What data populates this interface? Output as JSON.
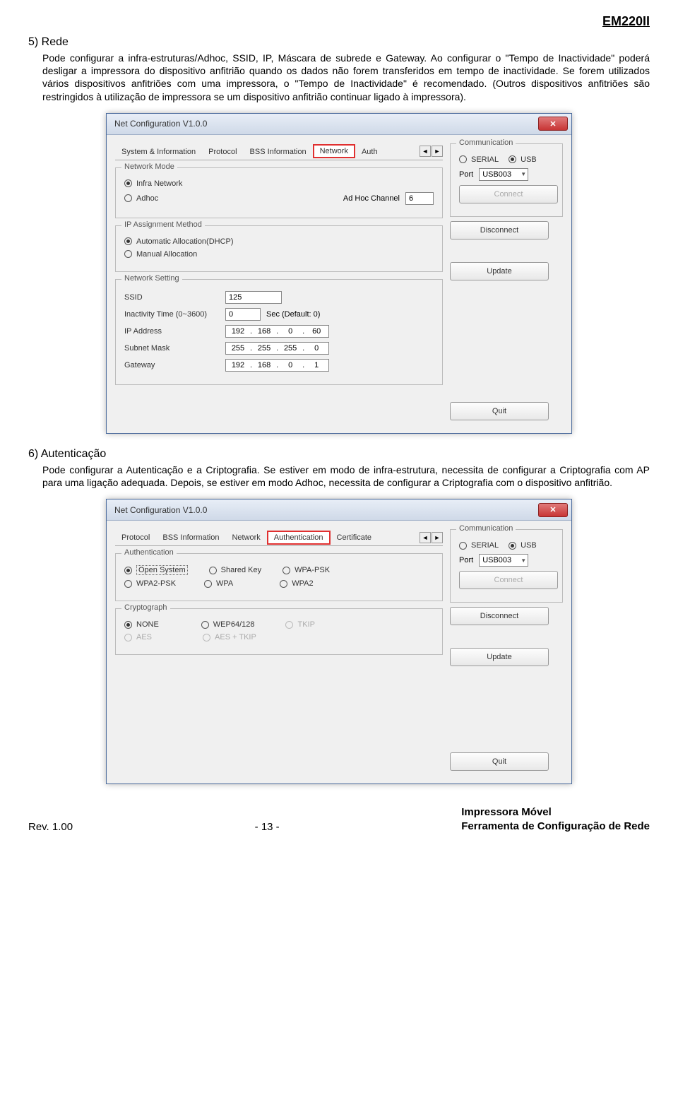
{
  "header": {
    "model": "EM220II"
  },
  "section5": {
    "title": "5) Rede",
    "body": "Pode configurar a infra-estruturas/Adhoc, SSID, IP, Máscara de subrede e Gateway. Ao configurar o \"Tempo de Inactividade\" poderá desligar a impressora do dispositivo anfitrião quando os dados não forem transferidos em tempo de inactividade. Se forem utilizados vários dispositivos anfitriões com uma impressora, o \"Tempo de Inactividade\" é recomendado. (Outros dispositivos anfitriões são restringidos à utilização de impressora se um dispositivo anfitrião continuar ligado à impressora)."
  },
  "section6": {
    "title": "6) Autenticação",
    "body": "Pode configurar a Autenticação e a Criptografia. Se estiver em modo de infra-estrutura, necessita de configurar a Criptografia com AP para uma ligação adequada. Depois, se estiver em modo Adhoc, necessita de configurar a Criptografia com o dispositivo anfitrião."
  },
  "win": {
    "title": "Net Configuration V1.0.0",
    "tabs1": [
      "System & Information",
      "Protocol",
      "BSS Information",
      "Network",
      "Auth"
    ],
    "tabs2": [
      "Protocol",
      "BSS Information",
      "Network",
      "Authentication",
      "Certificate"
    ],
    "grp": {
      "netmode": "Network Mode",
      "infra": "Infra Network",
      "adhoc": "Adhoc",
      "adhocch": "Ad Hoc Channel",
      "adhocch_val": "6",
      "ipassign": "IP Assignment Method",
      "dhcp": "Automatic Allocation(DHCP)",
      "manual": "Manual Allocation",
      "netset": "Network Setting",
      "ssid_l": "SSID",
      "ssid_v": "125",
      "inact_l": "Inactivity Time (0~3600)",
      "inact_v": "0",
      "inact_s": "Sec (Default: 0)",
      "ip_l": "IP Address",
      "ip_v": [
        "192",
        "168",
        "0",
        "60"
      ],
      "sm_l": "Subnet Mask",
      "sm_v": [
        "255",
        "255",
        "255",
        "0"
      ],
      "gw_l": "Gateway",
      "gw_v": [
        "192",
        "168",
        "0",
        "1"
      ],
      "auth": "Authentication",
      "auth_opts": [
        "Open System",
        "Shared Key",
        "WPA-PSK",
        "WPA2-PSK",
        "WPA",
        "WPA2"
      ],
      "crypt": "Cryptograph",
      "crypt_opts": [
        "NONE",
        "WEP64/128",
        "TKIP",
        "AES",
        "AES + TKIP"
      ]
    },
    "comm": {
      "title": "Communication",
      "serial": "SERIAL",
      "usb": "USB",
      "port_l": "Port",
      "port_v": "USB003",
      "connect": "Connect",
      "disconnect": "Disconnect",
      "update": "Update",
      "quit": "Quit"
    }
  },
  "footer": {
    "rev": "Rev. 1.00",
    "page": "- 13 -",
    "prod1": "Impressora Móvel",
    "prod2": "Ferramenta de Configuração de Rede"
  }
}
